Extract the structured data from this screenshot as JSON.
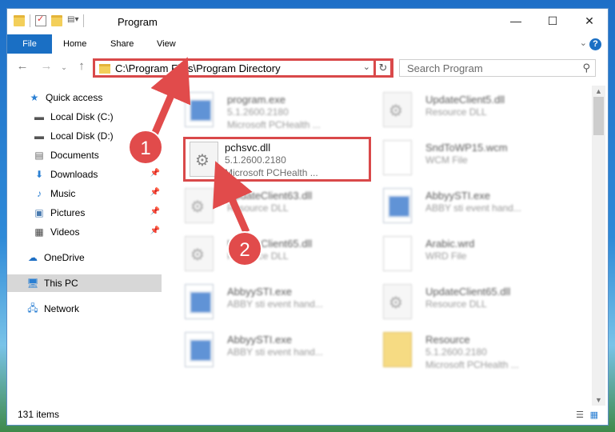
{
  "window": {
    "title": "Program"
  },
  "ribbon": {
    "tabs": [
      "File",
      "Home",
      "Share",
      "View"
    ]
  },
  "address": {
    "path": "C:\\Program Files\\Program Directory"
  },
  "search": {
    "placeholder": "Search Program"
  },
  "sidebar": {
    "items": [
      {
        "label": "Quick access",
        "icon": "star-icon"
      },
      {
        "label": "Local Disk (C:)",
        "icon": "drive-icon"
      },
      {
        "label": "Local Disk (D:)",
        "icon": "drive-icon"
      },
      {
        "label": "Documents",
        "icon": "documents-icon"
      },
      {
        "label": "Downloads",
        "icon": "downloads-icon"
      },
      {
        "label": "Music",
        "icon": "music-icon"
      },
      {
        "label": "Pictures",
        "icon": "pictures-icon"
      },
      {
        "label": "Videos",
        "icon": "videos-icon"
      },
      {
        "label": "OneDrive",
        "icon": "onedrive-icon"
      },
      {
        "label": "This PC",
        "icon": "computer-icon"
      },
      {
        "label": "Network",
        "icon": "network-icon"
      }
    ]
  },
  "files": [
    {
      "name": "program.exe",
      "line1": "5.1.2600.2180",
      "line2": "Microsoft PCHealth ...",
      "icon": "exe"
    },
    {
      "name": "UpdateClient5.dll",
      "line1": "Resource DLL",
      "line2": "",
      "icon": "gear"
    },
    {
      "name": "pchsvc.dll",
      "line1": "5.1.2600.2180",
      "line2": "Microsoft PCHealth ...",
      "icon": "gear"
    },
    {
      "name": "SndToWP15.wcm",
      "line1": "WCM File",
      "line2": "",
      "icon": "doc"
    },
    {
      "name": "UpdateClient63.dll",
      "line1": "Resource DLL",
      "line2": "",
      "icon": "gear"
    },
    {
      "name": "AbbyySTI.exe",
      "line1": "ABBY sti event hand...",
      "line2": "",
      "icon": "exe"
    },
    {
      "name": "UpdateClient65.dll",
      "line1": "Resource DLL",
      "line2": "",
      "icon": "gear"
    },
    {
      "name": "Arabic.wrd",
      "line1": "WRD File",
      "line2": "",
      "icon": "doc"
    },
    {
      "name": "AbbyySTI.exe",
      "line1": "ABBY sti event hand...",
      "line2": "",
      "icon": "exe"
    },
    {
      "name": "UpdateClient65.dll",
      "line1": "Resource DLL",
      "line2": "",
      "icon": "gear"
    },
    {
      "name": "AbbyySTI.exe",
      "line1": "ABBY sti event hand...",
      "line2": "",
      "icon": "exe"
    },
    {
      "name": "Resource",
      "line1": "5.1.2600.2180",
      "line2": "Microsoft PCHealth ...",
      "icon": "folder"
    }
  ],
  "callouts": [
    "1",
    "2"
  ],
  "status": {
    "items": "131 items"
  },
  "colors": {
    "accent": "#1a6fc4",
    "highlight": "#d9494a"
  }
}
